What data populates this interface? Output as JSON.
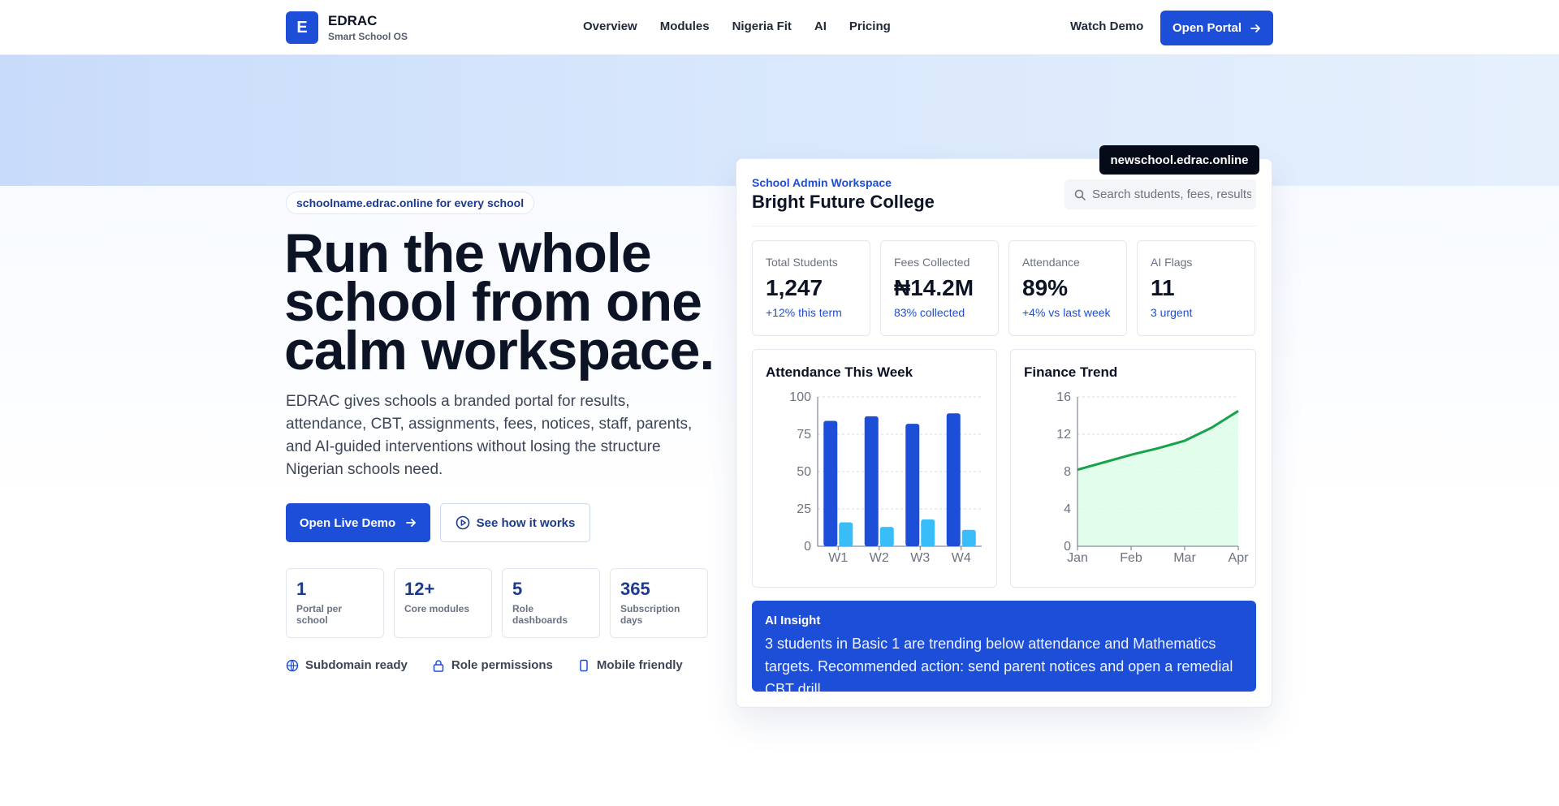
{
  "brand": {
    "logo_letter": "E",
    "name": "EDRAC",
    "tagline": "Smart School OS"
  },
  "nav": {
    "items": [
      "Overview",
      "Modules",
      "Nigeria Fit",
      "AI",
      "Pricing"
    ]
  },
  "header": {
    "watch_demo": "Watch Demo",
    "open_portal": "Open Portal"
  },
  "hero": {
    "pill": "schoolname.edrac.online for every school",
    "headline": "Run the whole school from one calm workspace.",
    "lead": "EDRAC gives schools a branded portal for results, attendance, CBT, assignments, fees, notices, staff, parents, and AI-guided interventions without losing the structure Nigerian schools need.",
    "cta_primary": "Open Live Demo",
    "cta_secondary": "See how it works",
    "stats": [
      {
        "value": "1",
        "label": "Portal per school"
      },
      {
        "value": "12+",
        "label": "Core modules"
      },
      {
        "value": "5",
        "label": "Role dashboards"
      },
      {
        "value": "365",
        "label": "Subscription days"
      }
    ],
    "features": [
      {
        "label": "Subdomain ready",
        "icon": "globe-icon"
      },
      {
        "label": "Role permissions",
        "icon": "lock-icon"
      },
      {
        "label": "Mobile friendly",
        "icon": "phone-icon"
      }
    ]
  },
  "dashboard": {
    "domain_badge": "newschool.edrac.online",
    "workspace_label": "School Admin Workspace",
    "school_name": "Bright Future College",
    "search_placeholder": "Search students, fees, results",
    "kpis": [
      {
        "label": "Total Students",
        "value": "1,247",
        "delta": "+12% this term"
      },
      {
        "label": "Fees Collected",
        "value": "₦14.2M",
        "delta": "83% collected"
      },
      {
        "label": "Attendance",
        "value": "89%",
        "delta": "+4% vs last week"
      },
      {
        "label": "AI Flags",
        "value": "11",
        "delta": "3 urgent"
      }
    ],
    "insight": {
      "title": "AI Insight",
      "text": "3 students in Basic 1 are trending below attendance and Mathematics targets. Recommended action: send parent notices and open a remedial CBT drill."
    }
  },
  "colors": {
    "primary": "#1d4ed8",
    "secondary_bar": "#38bdf8",
    "trend_line": "#16a34a",
    "trend_fill": "#dcfce7"
  },
  "chart_data": [
    {
      "type": "bar",
      "title": "Attendance This Week",
      "categories": [
        "W1",
        "W2",
        "W3",
        "W4"
      ],
      "series": [
        {
          "values": [
            84,
            87,
            82,
            89
          ]
        },
        {
          "values": [
            16,
            13,
            18,
            11
          ]
        }
      ],
      "yticks": [
        0,
        25,
        50,
        75,
        100
      ],
      "ylim": [
        0,
        100
      ],
      "grid": true
    },
    {
      "type": "area",
      "title": "Finance Trend",
      "categories": [
        "Jan",
        "Feb",
        "Mar",
        "Apr"
      ],
      "x_points": [
        0,
        0.5,
        1,
        1.5,
        2,
        2.5,
        3
      ],
      "values": [
        8.2,
        9.0,
        9.8,
        10.5,
        11.3,
        12.7,
        14.5
      ],
      "yticks": [
        0,
        4,
        8,
        12,
        16
      ],
      "ylim": [
        0,
        16
      ],
      "grid": true
    }
  ]
}
